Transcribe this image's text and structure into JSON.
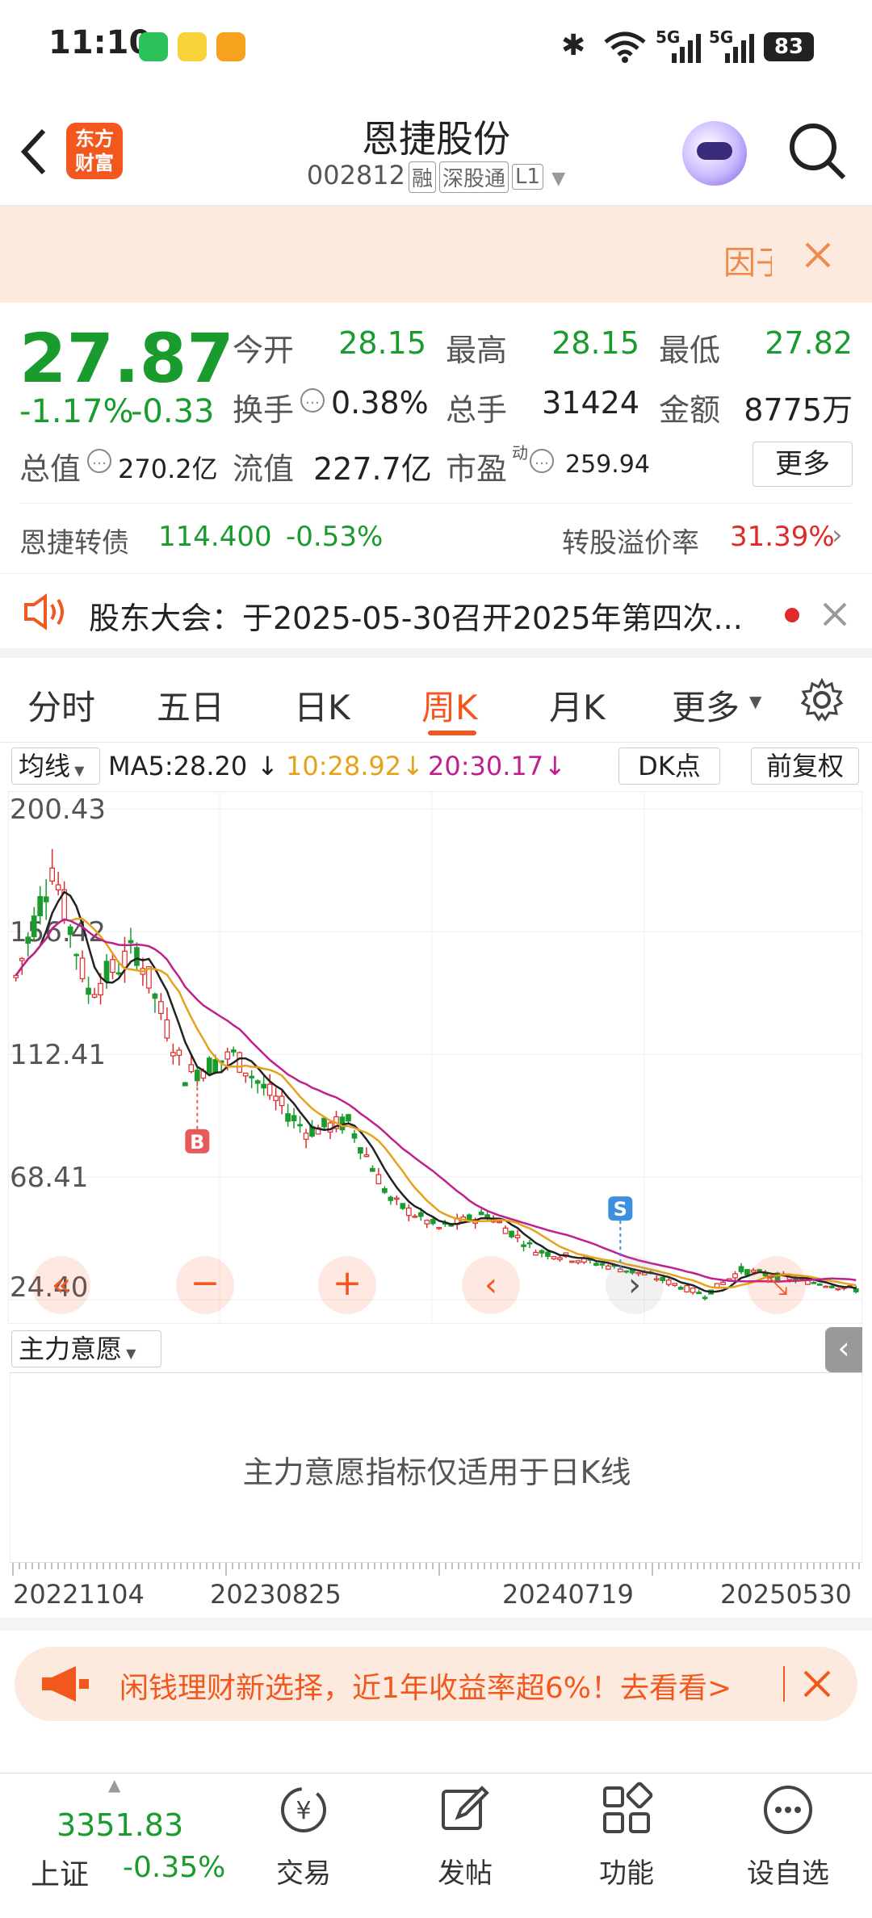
{
  "status_bar": {
    "time": "11:10",
    "network_1": "5G",
    "network_2": "5G",
    "battery": "83"
  },
  "header": {
    "logo_text_1": "东方",
    "logo_text_2": "财富",
    "stock_name": "恩捷股份",
    "stock_code": "002812",
    "tags": [
      "融",
      "深股通",
      "L1"
    ]
  },
  "banner": {
    "text": "因子"
  },
  "quote": {
    "price": "27.87",
    "change_pct": "-1.17%",
    "change": "-0.33",
    "open_label": "今开",
    "open": "28.15",
    "high_label": "最高",
    "high": "28.15",
    "low_label": "最低",
    "low": "27.82",
    "turnover_label": "换手",
    "turnover": "0.38%",
    "volume_label": "总手",
    "volume": "31424",
    "amount_label": "金额",
    "amount": "8775万",
    "mcap_label": "总值",
    "mcap": "270.2亿",
    "float_label": "流值",
    "float": "227.7亿",
    "pe_label": "市盈",
    "pe_sup": "动",
    "pe": "259.94",
    "more_button": "更多",
    "bond_label": "恩捷转债",
    "bond_price": "114.400",
    "bond_change": "-0.53%",
    "premium_label": "转股溢价率",
    "premium": "31.39%"
  },
  "news": {
    "text": "股东大会：于2025-05-30召开2025年第四次..."
  },
  "tabs": {
    "items": [
      "分时",
      "五日",
      "日K",
      "周K",
      "月K",
      "更多"
    ],
    "active_index": 3
  },
  "ma_row": {
    "ma_button": "均线",
    "ma5": "MA5:28.20",
    "ma10": "10:28.92",
    "ma20": "20:30.17",
    "dk_button": "DK点",
    "adjust_button": "前复权",
    "colors": {
      "ma5": "#222222",
      "ma10": "#e6a21b",
      "ma20": "#c0208e"
    }
  },
  "chart_data": {
    "type": "candlestick",
    "y_ticks": [
      "200.43",
      "156.42",
      "112.41",
      "68.41",
      "24.40"
    ],
    "ylim": [
      24.4,
      200.43
    ],
    "x_ticks": [
      "20221104",
      "20230825",
      "20240719",
      "20250530"
    ],
    "markers": [
      {
        "label": "B",
        "color": "#e85a5a"
      },
      {
        "label": "S",
        "color": "#3f8fe0"
      }
    ],
    "indicator_button": "主力意愿",
    "indicator_message": "主力意愿指标仅适用于日K线"
  },
  "promo": {
    "text": "闲钱理财新选择，近1年收益率超6%！去看看>"
  },
  "bottom_bar": {
    "index_value": "3351.83",
    "index_name": "上证",
    "index_change": "-0.35%",
    "items": [
      "交易",
      "发帖",
      "功能",
      "设自选"
    ]
  }
}
